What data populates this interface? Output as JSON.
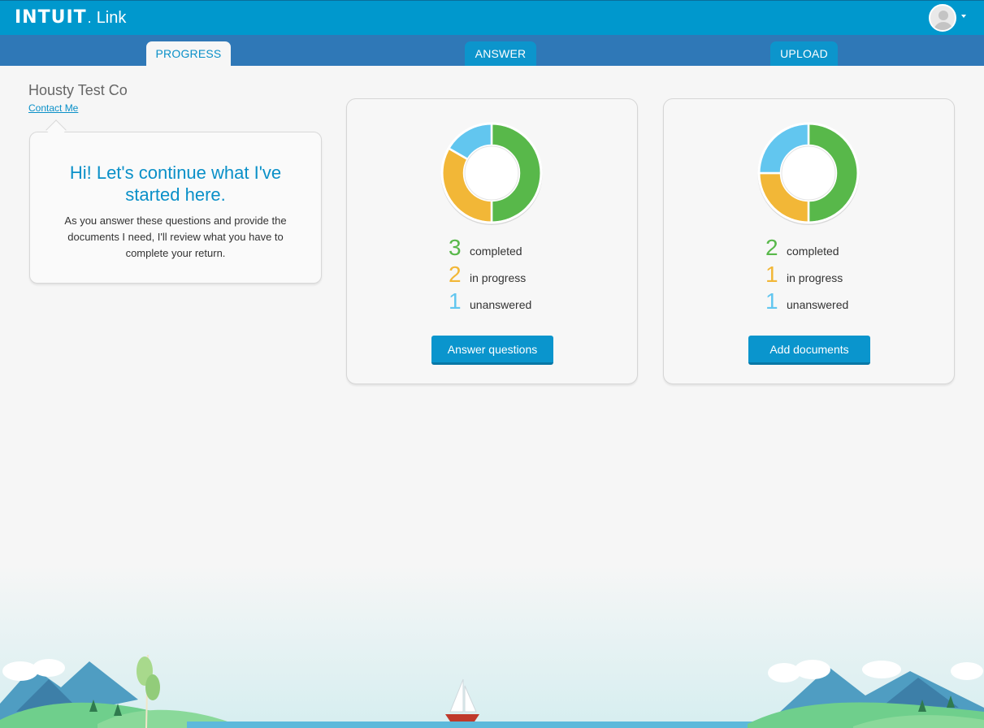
{
  "header": {
    "logo": "INTUIT",
    "logo_dot": ".",
    "product": "Link"
  },
  "tabs": [
    {
      "label": "PROGRESS",
      "active": true
    },
    {
      "label": "ANSWER",
      "active": false
    },
    {
      "label": "UPLOAD",
      "active": false
    }
  ],
  "company": {
    "name": "Housty Test Co",
    "contact_label": "Contact Me"
  },
  "welcome": {
    "title": "Hi! Let's continue what I've started here.",
    "body": "As you answer these questions and provide the documents I need, I'll review what you have to complete your return."
  },
  "colors": {
    "brand_blue": "#0098cd",
    "tab_bar": "#2f78b7",
    "completed": "#58b84a",
    "in_progress": "#f2b737",
    "unanswered": "#62c6ef"
  },
  "cards": [
    {
      "stats": [
        {
          "count": "3",
          "label": "completed"
        },
        {
          "count": "2",
          "label": "in progress"
        },
        {
          "count": "1",
          "label": "unanswered"
        }
      ],
      "button_label": "Answer questions"
    },
    {
      "stats": [
        {
          "count": "2",
          "label": "completed"
        },
        {
          "count": "1",
          "label": "in progress"
        },
        {
          "count": "1",
          "label": "unanswered"
        }
      ],
      "button_label": "Add documents"
    }
  ],
  "chart_data": [
    {
      "type": "pie",
      "categories": [
        "completed",
        "in progress",
        "unanswered"
      ],
      "values": [
        3,
        2,
        1
      ]
    },
    {
      "type": "pie",
      "categories": [
        "completed",
        "in progress",
        "unanswered"
      ],
      "values": [
        2,
        1,
        1
      ]
    }
  ]
}
